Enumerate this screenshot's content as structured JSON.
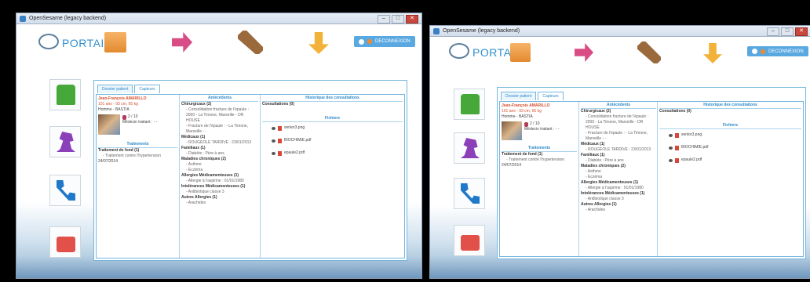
{
  "window": {
    "title": "OpenSesame (legacy backend)"
  },
  "header": {
    "portail": "PORTAIL",
    "logout": "DECONNEXION"
  },
  "tabs": [
    "Dossier patient",
    "Capteurs"
  ],
  "patient": {
    "name": "Jean-François AMARILLO",
    "info": "101 ans - 93 cm, 65 kg",
    "location": "Homme - BASTIA",
    "meds": "2 / 10",
    "doctor": "Médecin traitant : - -"
  },
  "traitements": {
    "title": "Traitements",
    "lines": [
      "Traitement de fond (1)",
      "- Traitement contre l'hypertension",
      "24/07/2014"
    ]
  },
  "antecedents": {
    "title": "Antécédents",
    "lines": [
      {
        "t": "Chirurgicaux (2)",
        "k": "sec"
      },
      {
        "t": "- Consolidation fracture de l'épaule : 2000 - La Timone, Marseille - DR HOUSE",
        "k": "sub"
      },
      {
        "t": "- Fracture de l'épaule : - La Timone, Marseille - -",
        "k": "sub"
      },
      {
        "t": "Médicaux (1)",
        "k": "sec"
      },
      {
        "t": "- ROUGEOLE TARDIVE : 23/01/2013",
        "k": "sub"
      },
      {
        "t": "Familiaux (1)",
        "k": "sec"
      },
      {
        "t": "- Diabète : Père à ans",
        "k": "sub"
      },
      {
        "t": "Maladies chroniques (2)",
        "k": "sec"
      },
      {
        "t": "- Asthme",
        "k": "sub"
      },
      {
        "t": "- Eczéma",
        "k": "sub"
      },
      {
        "t": "Allergies Médicamenteuses (1)",
        "k": "sec"
      },
      {
        "t": "- Allergie à l'aspirine : 01/01/1980",
        "k": "sub"
      },
      {
        "t": "Intolérances Médicamenteuses (1)",
        "k": "sec"
      },
      {
        "t": "- Antibiotique classe 3",
        "k": "sub"
      },
      {
        "t": "Autres Allergies (1)",
        "k": "sec"
      },
      {
        "t": "- Arachides",
        "k": "sub"
      }
    ]
  },
  "historique": {
    "title": "Historique des consultations",
    "consultations": "Consultations (0)"
  },
  "fichiers": {
    "title": "Fichiers",
    "files": [
      "senior3.png",
      "BIOCHIMIE.pdf",
      "epaule2.pdf"
    ]
  },
  "colors": {
    "accent": "#2b89c7",
    "name": "#d6502b"
  }
}
